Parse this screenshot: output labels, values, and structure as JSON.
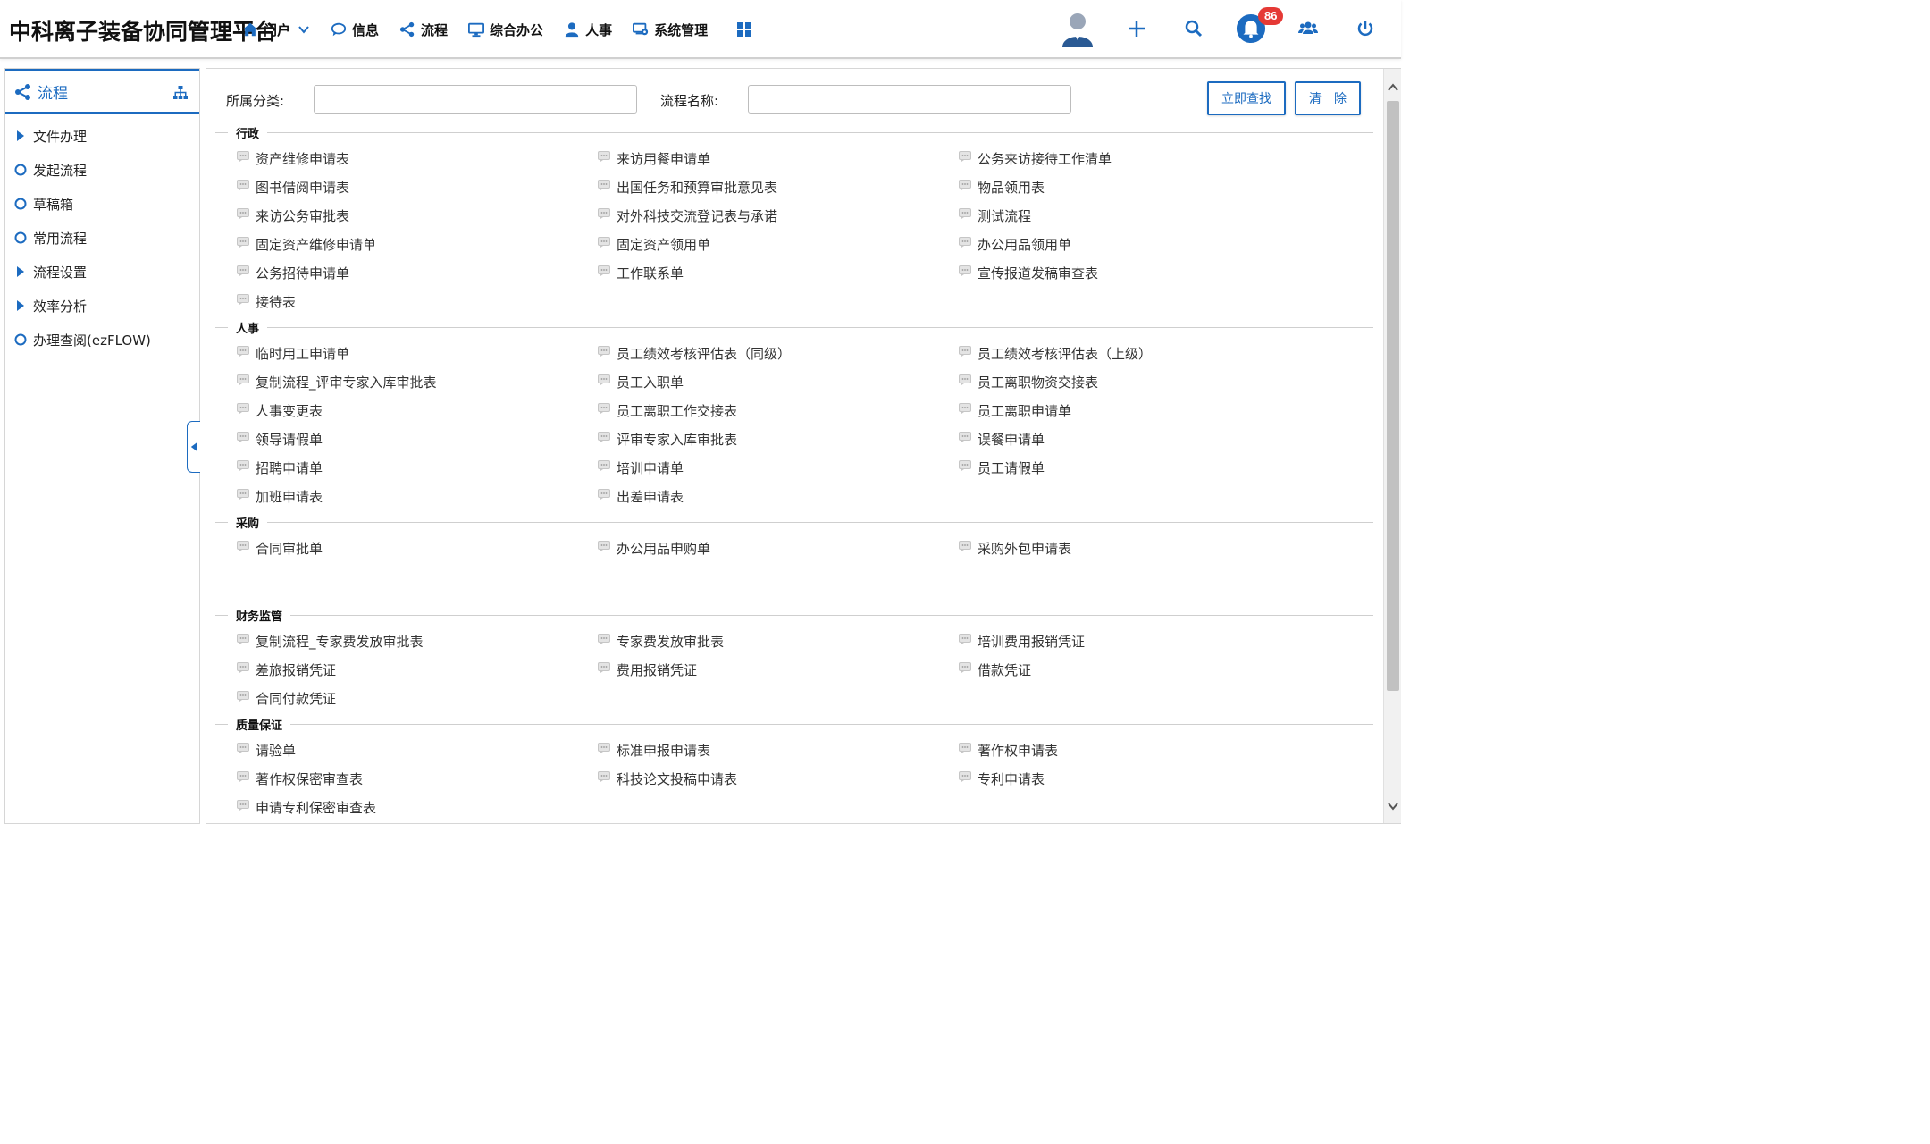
{
  "header": {
    "logo": "中科离子装备协同管理平台",
    "nav": [
      {
        "label": "门户",
        "icon": "home-icon",
        "has_dropdown": true
      },
      {
        "label": "信息",
        "icon": "chat-icon"
      },
      {
        "label": "流程",
        "icon": "share-icon"
      },
      {
        "label": "综合办公",
        "icon": "monitor-icon"
      },
      {
        "label": "人事",
        "icon": "user-icon"
      },
      {
        "label": "系统管理",
        "icon": "settings-monitor-icon"
      }
    ],
    "notifications_count": "86",
    "accent_color": "#1c6bc0"
  },
  "sidebar": {
    "title": "流程",
    "items": [
      {
        "label": "文件办理",
        "marker": "triangle"
      },
      {
        "label": "发起流程",
        "marker": "circle"
      },
      {
        "label": "草稿箱",
        "marker": "circle"
      },
      {
        "label": "常用流程",
        "marker": "circle"
      },
      {
        "label": "流程设置",
        "marker": "triangle"
      },
      {
        "label": "效率分析",
        "marker": "triangle"
      },
      {
        "label": "办理查阅(ezFLOW)",
        "marker": "circle"
      }
    ]
  },
  "search": {
    "category_label": "所属分类:",
    "category_value": "",
    "name_label": "流程名称:",
    "name_value": "",
    "search_button": "立即查找",
    "clear_button": "清　除"
  },
  "categories": [
    {
      "title": "行政",
      "items": [
        "资产维修申请表",
        "来访用餐申请单",
        "公务来访接待工作清单",
        "图书借阅申请表",
        "出国任务和预算审批意见表",
        "物品领用表",
        "来访公务审批表",
        "对外科技交流登记表与承诺",
        "测试流程",
        "固定资产维修申请单",
        "固定资产领用单",
        "办公用品领用单",
        "公务招待申请单",
        "工作联系单",
        "宣传报道发稿审查表",
        "接待表"
      ]
    },
    {
      "title": "人事",
      "items": [
        "临时用工申请单",
        "员工绩效考核评估表（同级）",
        "员工绩效考核评估表（上级）",
        "复制流程_评审专家入库审批表",
        "员工入职单",
        "员工离职物资交接表",
        "人事变更表",
        "员工离职工作交接表",
        "员工离职申请单",
        "领导请假单",
        "评审专家入库审批表",
        "误餐申请单",
        "招聘申请单",
        "培训申请单",
        "员工请假单",
        "加班申请表",
        "出差申请表"
      ]
    },
    {
      "title": "采购",
      "items": [
        "合同审批单",
        "办公用品申购单",
        "采购外包申请表"
      ],
      "extra_space": true
    },
    {
      "title": "财务监管",
      "items": [
        "复制流程_专家费发放审批表",
        "专家费发放审批表",
        "培训费用报销凭证",
        "差旅报销凭证",
        "费用报销凭证",
        "借款凭证",
        "合同付款凭证"
      ]
    },
    {
      "title": "质量保证",
      "items": [
        "请验单",
        "标准申报申请表",
        "著作权申请表",
        "著作权保密审查表",
        "科技论文投稿申请表",
        "专利申请表",
        "申请专利保密审查表"
      ]
    }
  ]
}
